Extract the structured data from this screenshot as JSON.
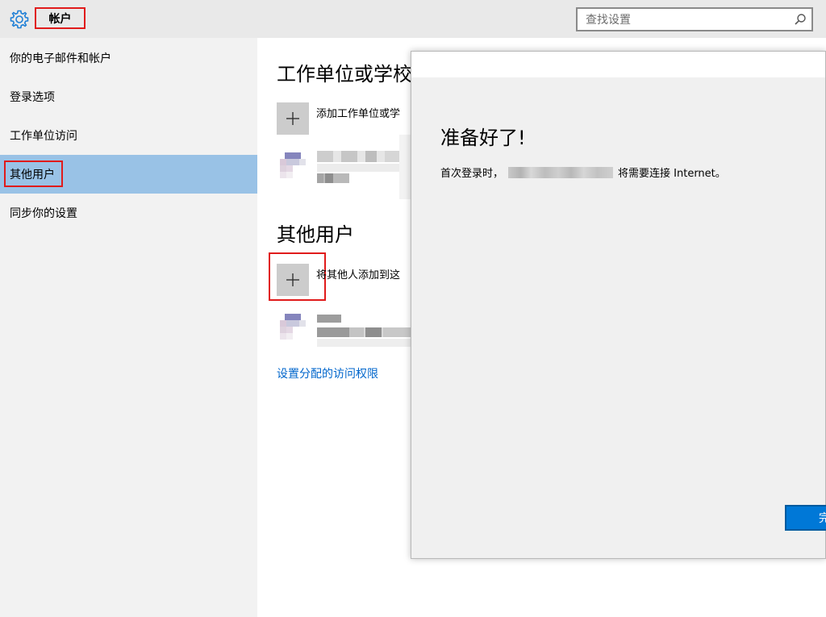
{
  "header": {
    "title": "帐户",
    "search_placeholder": "查找设置",
    "gear_icon": "gear-icon",
    "search_icon": "search-icon"
  },
  "sidebar": {
    "items": [
      {
        "label": "你的电子邮件和帐户"
      },
      {
        "label": "登录选项"
      },
      {
        "label": "工作单位访问"
      },
      {
        "label": "其他用户",
        "selected": true
      },
      {
        "label": "同步你的设置"
      }
    ]
  },
  "main": {
    "work_heading": "工作单位或学校",
    "add_work_label": "添加工作单位或学",
    "other_heading": "其他用户",
    "add_other_label": "将其他人添加到这",
    "assigned_access_link": "设置分配的访问权限"
  },
  "dialog": {
    "title": "准备好了!",
    "body_prefix": "首次登录时，",
    "body_suffix": "将需要连接 Internet。",
    "button_label": "完"
  },
  "colors": {
    "accent": "#0078d7",
    "selection": "#99c2e6",
    "highlight_box": "#e01b1b",
    "link": "#0066cc"
  }
}
